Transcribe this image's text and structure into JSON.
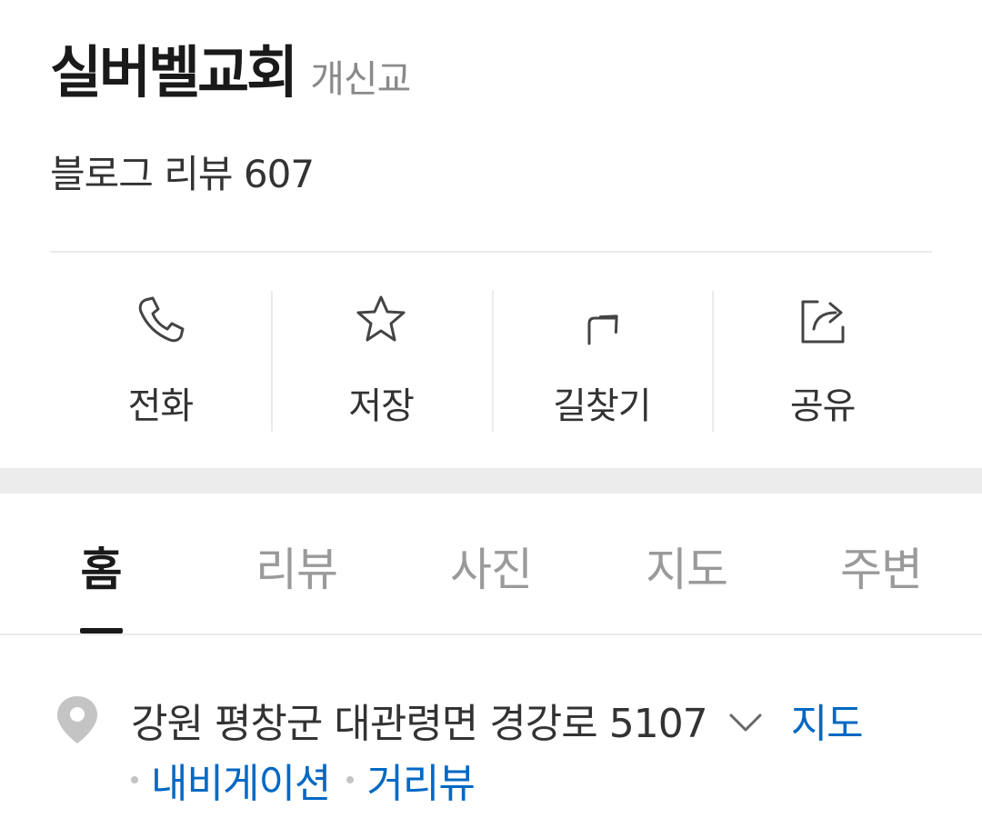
{
  "place": {
    "name": "실버벨교회",
    "category": "개신교",
    "review_label": "블로그 리뷰",
    "review_count": "607"
  },
  "actions": [
    {
      "label": "전화",
      "icon": "phone-icon"
    },
    {
      "label": "저장",
      "icon": "star-icon"
    },
    {
      "label": "길찾기",
      "icon": "directions-icon"
    },
    {
      "label": "공유",
      "icon": "share-icon"
    }
  ],
  "tabs": [
    {
      "label": "홈",
      "active": true
    },
    {
      "label": "리뷰",
      "active": false
    },
    {
      "label": "사진",
      "active": false
    },
    {
      "label": "지도",
      "active": false
    },
    {
      "label": "주변",
      "active": false
    }
  ],
  "address": {
    "text": "강원 평창군 대관령면 경강로 5107",
    "map_link": "지도",
    "navigation_link": "내비게이션",
    "streetview_link": "거리뷰"
  },
  "colors": {
    "link": "#0068c3",
    "active_tab": "#1a1a1a",
    "inactive_tab": "#9a9a9a",
    "divider": "#ebebeb"
  }
}
